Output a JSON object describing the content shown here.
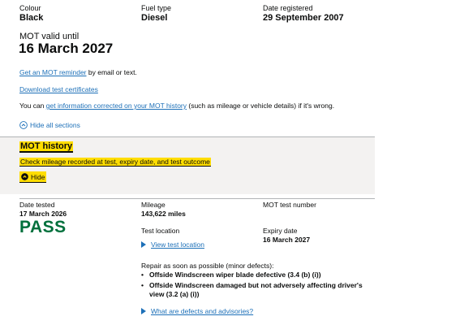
{
  "vehicle": {
    "colour_label": "Colour",
    "colour_value": "Black",
    "fuel_label": "Fuel type",
    "fuel_value": "Diesel",
    "registered_label": "Date registered",
    "registered_value": "29 September 2007"
  },
  "mot": {
    "valid_label": "MOT valid until",
    "valid_date": "16 March 2027"
  },
  "links": {
    "reminder_link": "Get an MOT reminder",
    "reminder_suffix": " by email or text.",
    "download_link": "Download test certificates",
    "corrected_prefix": "You can ",
    "corrected_link": "get information corrected on your MOT history",
    "corrected_suffix": " (such as mileage or vehicle details) if it's wrong.",
    "hide_all": "Hide all sections"
  },
  "history_panel": {
    "title": "MOT history",
    "subtitle": "Check mileage recorded at test, expiry date, and test outcome",
    "hide_label": "Hide"
  },
  "test": {
    "date_label": "Date tested",
    "date_value": "17 March 2026",
    "result": "PASS",
    "mileage_label": "Mileage",
    "mileage_value": "143,622 miles",
    "number_label": "MOT test number",
    "location_label": "Test location",
    "location_link": "View test location",
    "expiry_label": "Expiry date",
    "expiry_value": "16 March 2027",
    "repair_heading": "Repair as soon as possible (minor defects):",
    "defects": [
      "Offside Windscreen wiper blade defective (3.4 (b) (i))",
      "Offside Windscreen damaged but not adversely affecting driver's view (3.2 (a) (i))"
    ],
    "defects_link": "What are defects and advisories?"
  },
  "colors": {
    "link": "#1d70b8",
    "focus_yellow": "#ffdd00",
    "pass_green": "#00703c",
    "panel_grey": "#f3f2f1"
  }
}
